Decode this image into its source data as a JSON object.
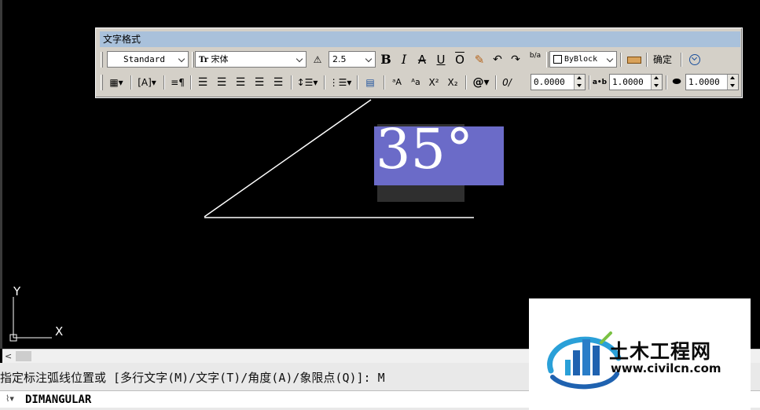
{
  "toolbar": {
    "title": "文字格式",
    "style_value": "Standard",
    "font_value": "宋体",
    "font_prefix": "Tr",
    "height_value": "2.5",
    "bold_label": "B",
    "italic_label": "I",
    "strike_label": "A",
    "underline_label": "U",
    "overline_label": "O",
    "color_value": "ByBlock",
    "ok_label": "确定",
    "oblique_value": "0.0000",
    "tracking_value": "1.0000",
    "width_value": "1.0000",
    "stack_label": "b/a",
    "superscript_label": "X²",
    "subscript_label": "X₂",
    "symbol_label": "@"
  },
  "drawing": {
    "dimension_text": "35°",
    "ucs_x_label": "X",
    "ucs_y_label": "Y"
  },
  "command": {
    "history": "指定标注弧线位置或 [多行文字(M)/文字(T)/角度(A)/象限点(Q)]: M",
    "input": "DIMANGULAR"
  },
  "watermark": {
    "title": "土木工程网",
    "url": "www.civilcn.com"
  },
  "colors": {
    "canvas": "#000000",
    "title_bar": "#a9c1db",
    "dim_highlight": "#6b6bc8",
    "watermark_blue": "#1f62b0"
  }
}
